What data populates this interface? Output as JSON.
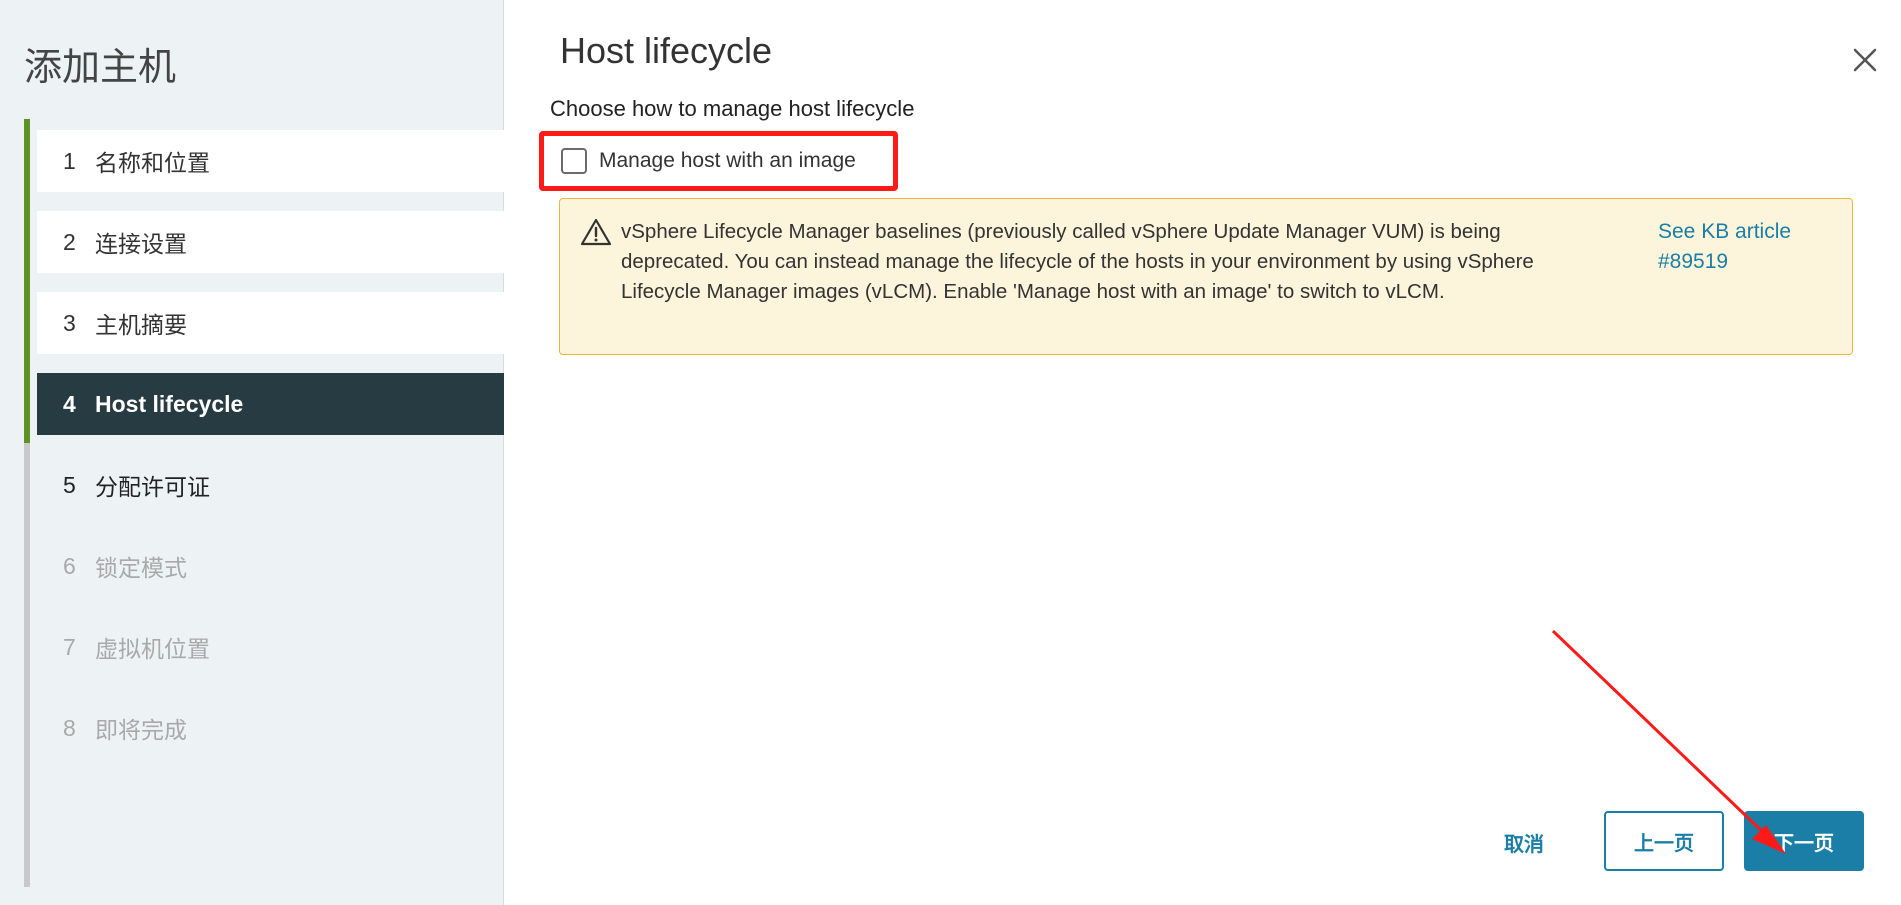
{
  "wizard": {
    "title": "添加主机",
    "steps": [
      {
        "num": "1",
        "label": "名称和位置",
        "state": "done"
      },
      {
        "num": "2",
        "label": "连接设置",
        "state": "done"
      },
      {
        "num": "3",
        "label": "主机摘要",
        "state": "done"
      },
      {
        "num": "4",
        "label": "Host lifecycle",
        "state": "active"
      },
      {
        "num": "5",
        "label": "分配许可证",
        "state": "todo"
      },
      {
        "num": "6",
        "label": "锁定模式",
        "state": "disabled"
      },
      {
        "num": "7",
        "label": "虚拟机位置",
        "state": "disabled"
      },
      {
        "num": "8",
        "label": "即将完成",
        "state": "disabled"
      }
    ]
  },
  "page": {
    "title": "Host lifecycle",
    "subtitle": "Choose how to manage host lifecycle",
    "checkbox_label": "Manage host with an image",
    "checkbox_checked": false
  },
  "alert": {
    "icon": "warning-icon",
    "text": "vSphere Lifecycle Manager baselines (previously called vSphere Update Manager VUM) is being deprecated. You can instead manage the lifecycle of the hosts in your environment by using vSphere Lifecycle Manager images (vLCM). Enable 'Manage host with an image' to switch to vLCM.",
    "link": "See KB article #89519"
  },
  "footer": {
    "cancel": "取消",
    "back": "上一页",
    "next": "下一页"
  },
  "colors": {
    "accent": "#1a7ea6",
    "active_step_bg": "#273b42",
    "progress_done": "#5b9425",
    "annotation_red": "#ff1a1a",
    "alert_bg": "#fdf4dc",
    "alert_border": "#e8b93b"
  }
}
